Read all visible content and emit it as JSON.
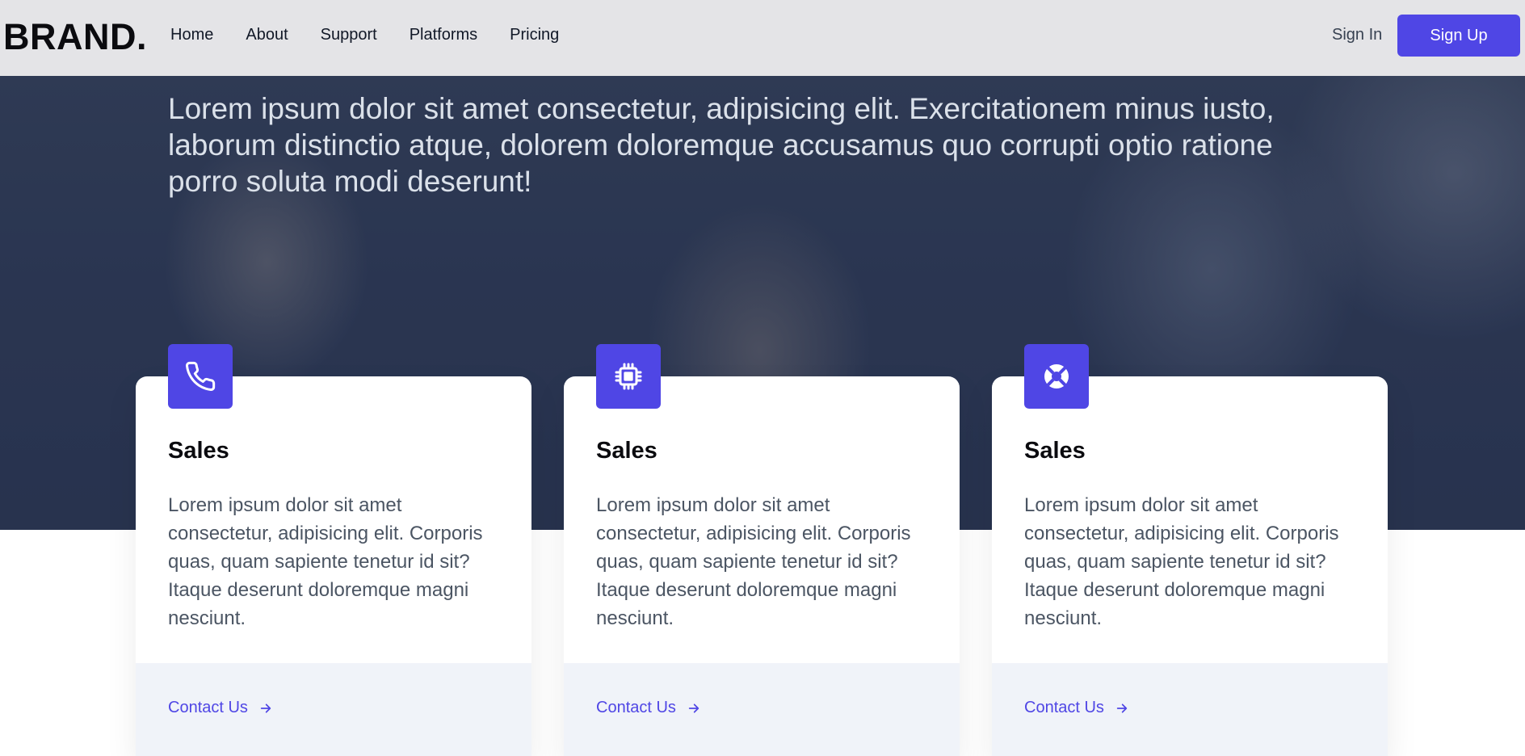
{
  "nav": {
    "brand": "BRAND.",
    "links": [
      "Home",
      "About",
      "Support",
      "Platforms",
      "Pricing"
    ],
    "sign_in": "Sign In",
    "sign_up": "Sign Up"
  },
  "hero": {
    "text": "Lorem ipsum dolor sit amet consectetur, adipisicing elit. Exercitationem minus iusto, laborum distinctio atque, dolorem doloremque accusamus quo corrupti optio ratione porro soluta modi deserunt!"
  },
  "cards": [
    {
      "icon": "phone-icon",
      "title": "Sales",
      "text": "Lorem ipsum dolor sit amet consectetur, adipisicing elit. Corporis quas, quam sapiente tenetur id sit? Itaque deserunt doloremque magni nesciunt.",
      "link": "Contact Us"
    },
    {
      "icon": "cpu-chip-icon",
      "title": "Sales",
      "text": "Lorem ipsum dolor sit amet consectetur, adipisicing elit. Corporis quas, quam sapiente tenetur id sit? Itaque deserunt doloremque magni nesciunt.",
      "link": "Contact Us"
    },
    {
      "icon": "lifebuoy-icon",
      "title": "Sales",
      "text": "Lorem ipsum dolor sit amet consectetur, adipisicing elit. Corporis quas, quam sapiente tenetur id sit? Itaque deserunt doloremque magni nesciunt.",
      "link": "Contact Us"
    }
  ],
  "colors": {
    "accent": "#4f46e5",
    "nav_bg": "#e4e4e7",
    "hero_overlay": "#2f3a55",
    "card_footer_bg": "#f0f3f9"
  }
}
